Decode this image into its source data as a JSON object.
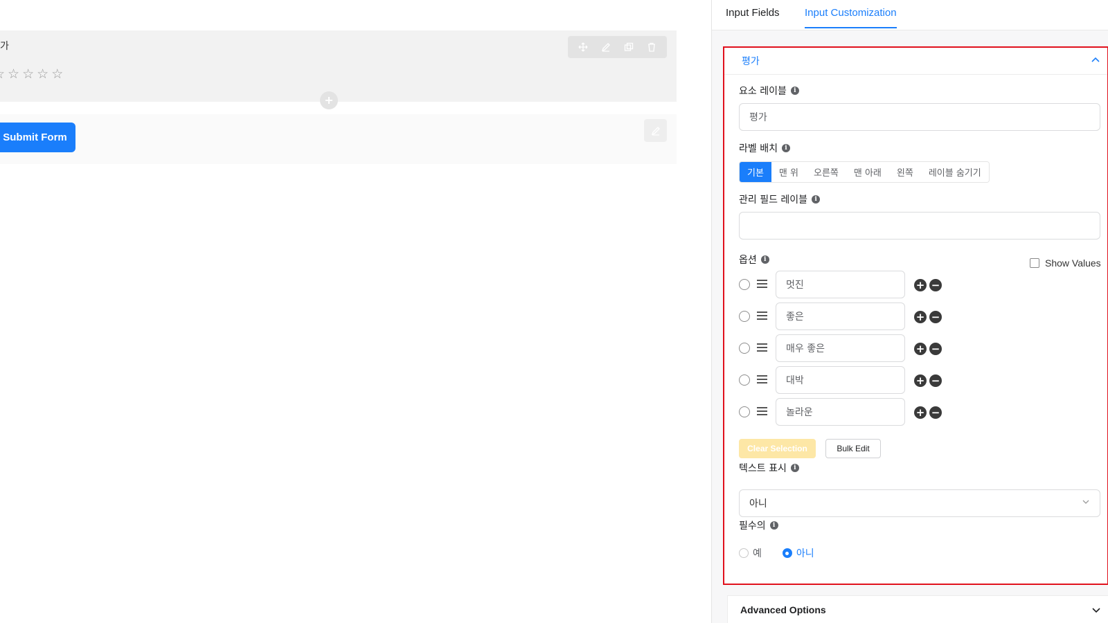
{
  "canvas": {
    "field_label": "가",
    "stars": [
      "☆",
      "☆",
      "☆",
      "☆",
      "☆"
    ],
    "submit_label": "Submit Form"
  },
  "tabs": [
    {
      "label": "Input Fields"
    },
    {
      "label": "Input Customization"
    }
  ],
  "card": {
    "title": "평가",
    "element_label": {
      "label": "요소 레이블",
      "value": "평가"
    },
    "label_placement": {
      "label": "라벨 배치",
      "options": [
        "기본",
        "맨 위",
        "오른쪽",
        "맨 아래",
        "왼쪽",
        "레이블 숨기기"
      ],
      "selected": "기본"
    },
    "admin_label": {
      "label": "관리 필드 레이블",
      "value": ""
    },
    "options": {
      "label": "옵션",
      "show_values": "Show Values",
      "items": [
        "멋진",
        "좋은",
        "매우 좋은",
        "대박",
        "놀라운"
      ],
      "plus": "+",
      "minus": "−",
      "clear_selection": "Clear Selection",
      "bulk_edit": "Bulk Edit"
    },
    "text_display": {
      "label": "텍스트 표시",
      "value": "아니"
    },
    "required": {
      "label": "필수의",
      "yes": "예",
      "no": "아니",
      "selected": "아니"
    }
  },
  "advanced": {
    "title": "Advanced Options"
  },
  "colors": {
    "accent": "#1a7efb",
    "highlight_border": "#e0101c",
    "clear_button": "#fde7a6"
  }
}
